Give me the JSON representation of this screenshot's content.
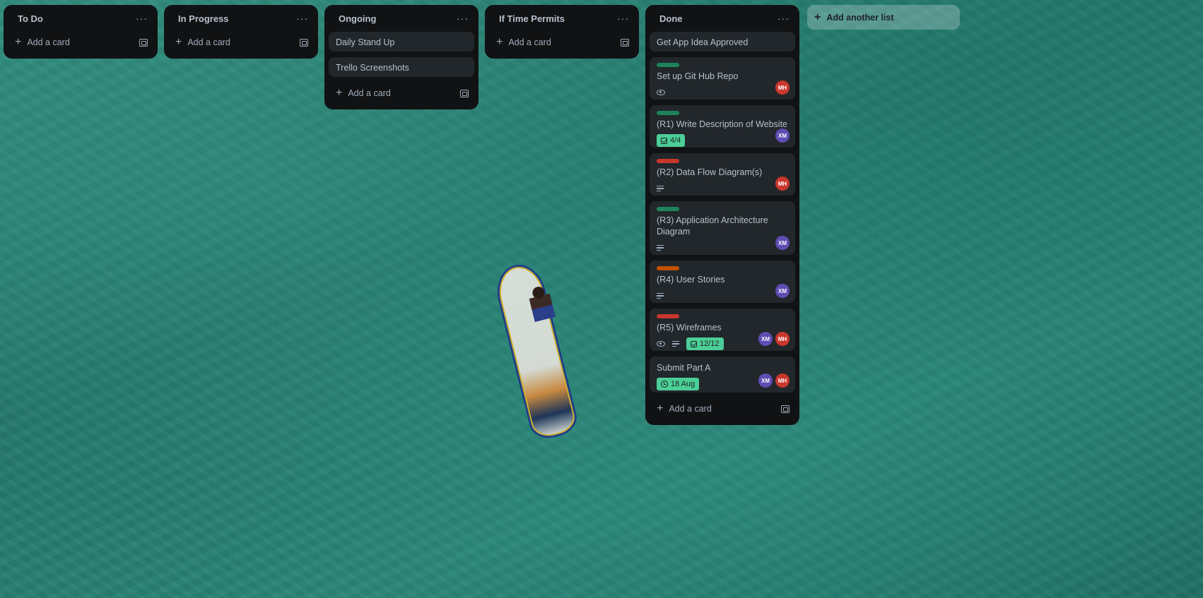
{
  "lists": {
    "todo": {
      "title": "To Do",
      "add_label": "Add a card"
    },
    "in_progress": {
      "title": "In Progress",
      "add_label": "Add a card"
    },
    "ongoing": {
      "title": "Ongoing",
      "cards": [
        "Daily Stand Up",
        "Trello Screenshots"
      ],
      "add_label": "Add a card"
    },
    "if_time": {
      "title": "If Time Permits",
      "add_label": "Add a card"
    },
    "done": {
      "title": "Done",
      "add_label": "Add a card",
      "cards": [
        {
          "title": "Get App Idea Approved"
        },
        {
          "title": "Set up Git Hub Repo",
          "label_color": "#1f845a",
          "members": [
            "MH"
          ]
        },
        {
          "title": "(R1) Write Description of Website",
          "label_color": "#1f845a",
          "checklist": "4/4",
          "members": [
            "XM"
          ]
        },
        {
          "title": "(R2) Data Flow Diagram(s)",
          "label_color": "#c9372c",
          "members": [
            "MH"
          ]
        },
        {
          "title": "(R3) Application Architecture Diagram",
          "label_color": "#1f845a",
          "members": [
            "XM"
          ]
        },
        {
          "title": "(R4) User Stories",
          "label_color": "#c25100",
          "members": [
            "XM"
          ]
        },
        {
          "title": "(R5) Wireframes",
          "label_color": "#c9372c",
          "checklist": "12/12",
          "members": [
            "XM",
            "MH"
          ]
        },
        {
          "title": "Submit Part A",
          "due": "18 Aug",
          "members": [
            "XM",
            "MH"
          ]
        }
      ]
    }
  },
  "add_list_label": "Add another list",
  "menu_glyph": "···",
  "plus_glyph": "+"
}
